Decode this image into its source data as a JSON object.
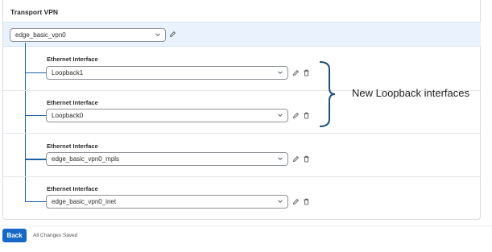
{
  "section": {
    "title": "Transport VPN"
  },
  "vpn": {
    "selected": "edge_basic_vpn0"
  },
  "interfaces": [
    {
      "label": "Ethernet Interface",
      "value": "Loopback1"
    },
    {
      "label": "Ethernet Interface",
      "value": "Loopback0"
    },
    {
      "label": "Ethernet Interface",
      "value": "edge_basic_vpn0_mpls"
    },
    {
      "label": "Ethernet Interface",
      "value": "edge_basic_vpn0_inet"
    }
  ],
  "annotation": {
    "text": "New Loopback interfaces"
  },
  "footer": {
    "back_label": "Back",
    "status": "All Changes Saved"
  },
  "colors": {
    "accent": "#1769c7",
    "tree": "#1f5fa8",
    "highlight": "#e9f2fd"
  }
}
